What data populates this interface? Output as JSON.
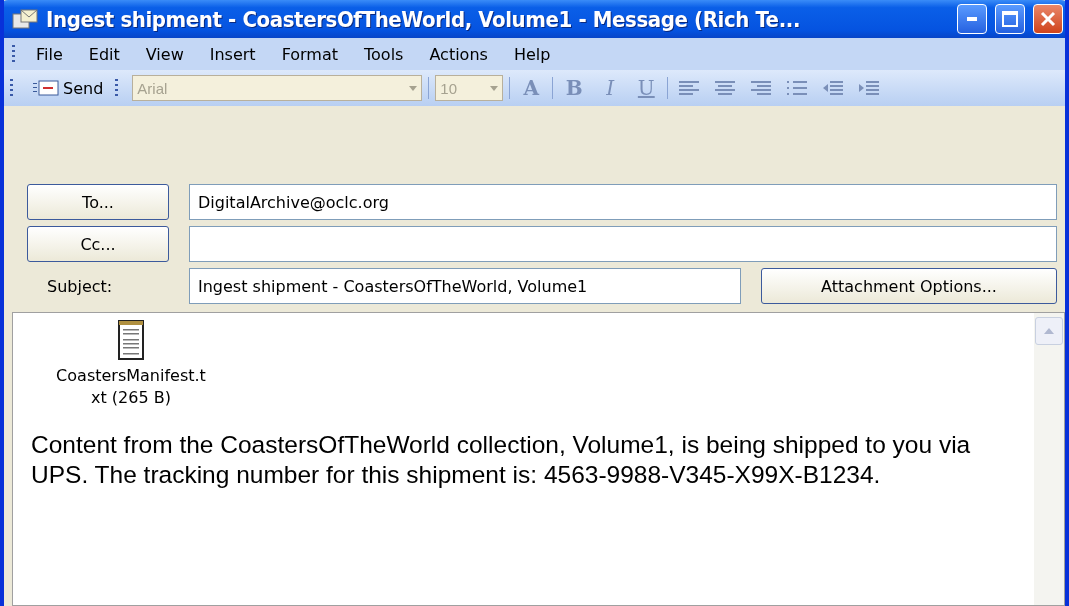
{
  "window": {
    "title": "Ingest shipment - CoastersOfTheWorld, Volume1 - Message (Rich Te..."
  },
  "menu": [
    {
      "label": "File"
    },
    {
      "label": "Edit"
    },
    {
      "label": "View"
    },
    {
      "label": "Insert"
    },
    {
      "label": "Format"
    },
    {
      "label": "Tools"
    },
    {
      "label": "Actions"
    },
    {
      "label": "Help"
    }
  ],
  "toolbar": {
    "send": {
      "label": "Send"
    },
    "font_name": {
      "value": "Arial",
      "disabled": true
    },
    "font_size": {
      "value": "10",
      "disabled": true
    },
    "format_buttons": [
      {
        "kind": "color",
        "label": "A"
      },
      {
        "kind": "bold",
        "label": "B"
      },
      {
        "kind": "italic",
        "label": "I"
      },
      {
        "kind": "underline",
        "label": "U"
      },
      {
        "kind": "align-left"
      },
      {
        "kind": "align-center"
      },
      {
        "kind": "align-right"
      },
      {
        "kind": "bullets"
      },
      {
        "kind": "outdent"
      },
      {
        "kind": "indent"
      }
    ]
  },
  "header": {
    "to": {
      "button": "To...",
      "value": "DigitalArchive@oclc.org"
    },
    "cc": {
      "button": "Cc..."
    },
    "subject": {
      "label": "Subject:",
      "value": "Ingest shipment - CoastersOfTheWorld, Volume1"
    },
    "attachment_options": "Attachment Options..."
  },
  "body": {
    "attachment": {
      "name_lines": [
        "CoastersManifest.t",
        "xt (265 B)"
      ]
    },
    "text": "Content from the CoastersOfTheWorld collection, Volume1, is being shipped to you via UPS. The tracking number for this shipment is: 4563-9988-V345-X99X-B1234."
  }
}
